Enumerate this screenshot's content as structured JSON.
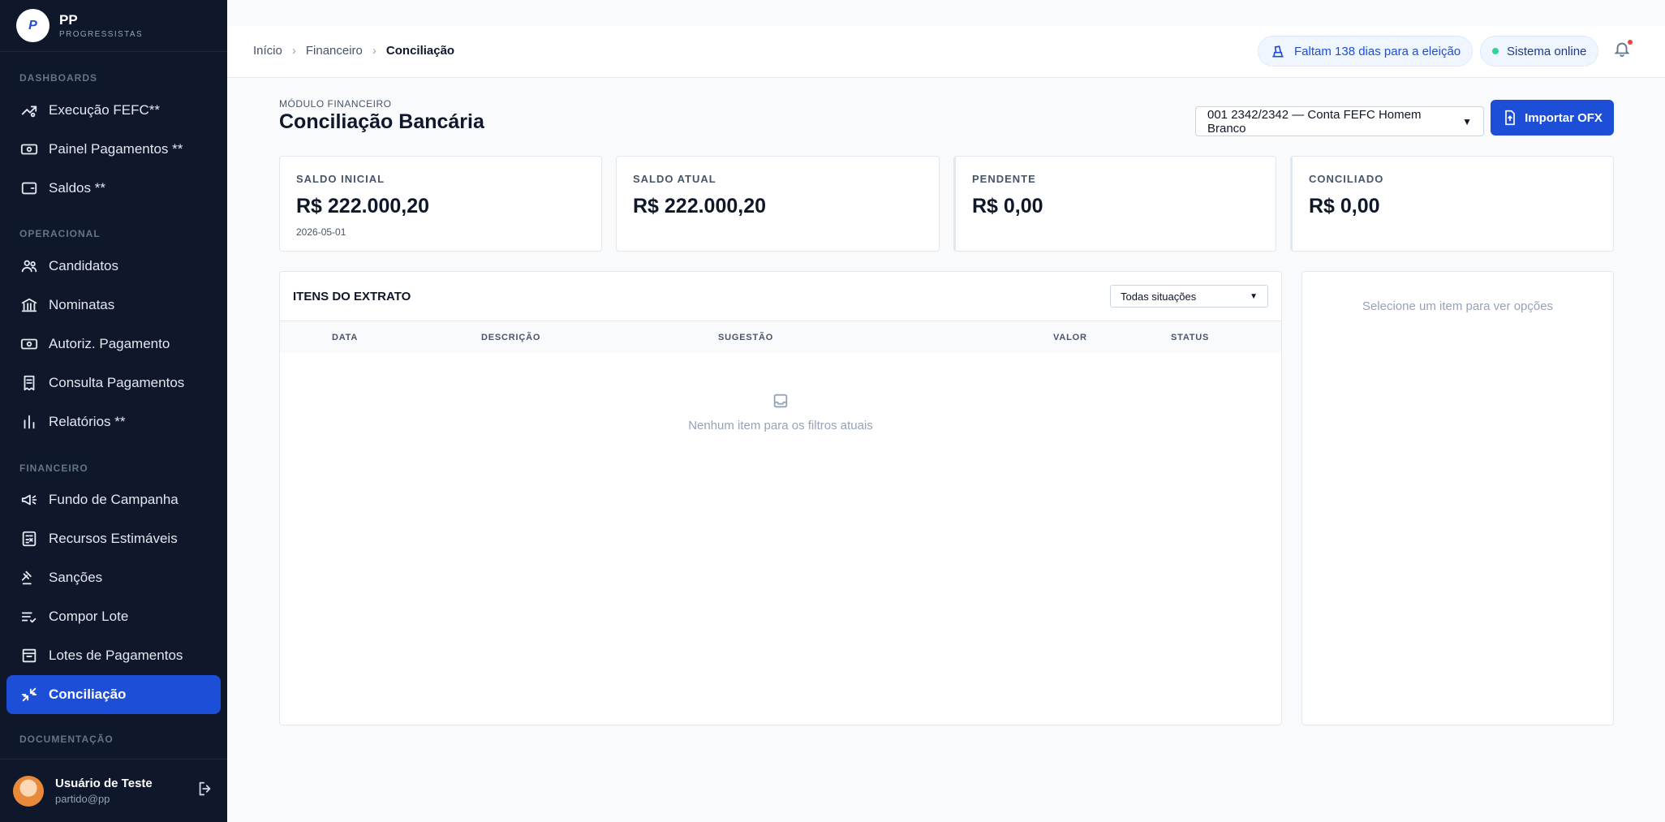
{
  "brand": {
    "name": "PP",
    "subtitle": "PROGRESSISTAS",
    "logo_letter": "P"
  },
  "sidebar": {
    "sections": {
      "dashboards": "DASHBOARDS",
      "operacional": "OPERACIONAL",
      "financeiro": "FINANCEIRO",
      "documentacao": "DOCUMENTAÇÃO"
    },
    "items": [
      {
        "label": "Execução FEFC**",
        "icon": "trending-up-icon"
      },
      {
        "label": "Painel Pagamentos **",
        "icon": "banknote-icon"
      },
      {
        "label": "Saldos **",
        "icon": "wallet-icon"
      },
      {
        "label": "Candidatos",
        "icon": "users-icon"
      },
      {
        "label": "Nominatas",
        "icon": "bank-icon"
      },
      {
        "label": "Autoriz. Pagamento",
        "icon": "banknote-icon"
      },
      {
        "label": "Consulta Pagamentos",
        "icon": "receipt-icon"
      },
      {
        "label": "Relatórios **",
        "icon": "bar-chart-icon"
      },
      {
        "label": "Fundo de Campanha",
        "icon": "megaphone-icon"
      },
      {
        "label": "Recursos Estimáveis",
        "icon": "calculator-icon"
      },
      {
        "label": "Sanções",
        "icon": "gavel-icon"
      },
      {
        "label": "Compor Lote",
        "icon": "list-check-icon"
      },
      {
        "label": "Lotes de Pagamentos",
        "icon": "archive-icon"
      },
      {
        "label": "Conciliação",
        "icon": "arrows-in-icon",
        "active": true
      }
    ]
  },
  "user": {
    "name": "Usuário de Teste",
    "email": "partido@pp"
  },
  "header": {
    "breadcrumb": [
      "Início",
      "Financeiro",
      "Conciliação"
    ],
    "election_notice": "Faltam 138 dias para a eleição",
    "status": "Sistema online"
  },
  "page": {
    "module": "MÓDULO FINANCEIRO",
    "title": "Conciliação Bancária",
    "account_selected": "001 2342/2342 — Conta FEFC Homem Branco",
    "import_label": "Importar OFX"
  },
  "cards": [
    {
      "label": "SALDO INICIAL",
      "value": "R$ 222.000,20",
      "sub": "2026-05-01"
    },
    {
      "label": "SALDO ATUAL",
      "value": "R$ 222.000,20",
      "sub": ""
    },
    {
      "label": "PENDENTE",
      "value": "R$ 0,00",
      "sub": ""
    },
    {
      "label": "CONCILIADO",
      "value": "R$ 0,00",
      "sub": ""
    }
  ],
  "extract": {
    "title": "ITENS DO EXTRATO",
    "filter_selected": "Todas situações",
    "columns": [
      "DATA",
      "DESCRIÇÃO",
      "SUGESTÃO",
      "VALOR",
      "STATUS"
    ],
    "empty_text": "Nenhum item para os filtros atuais"
  },
  "side_panel": {
    "hint": "Selecione um item para ver opções"
  },
  "colors": {
    "sidebar_bg": "#0f172a",
    "accent": "#1d4ed8",
    "online": "#34d399",
    "notification": "#ef4444"
  }
}
